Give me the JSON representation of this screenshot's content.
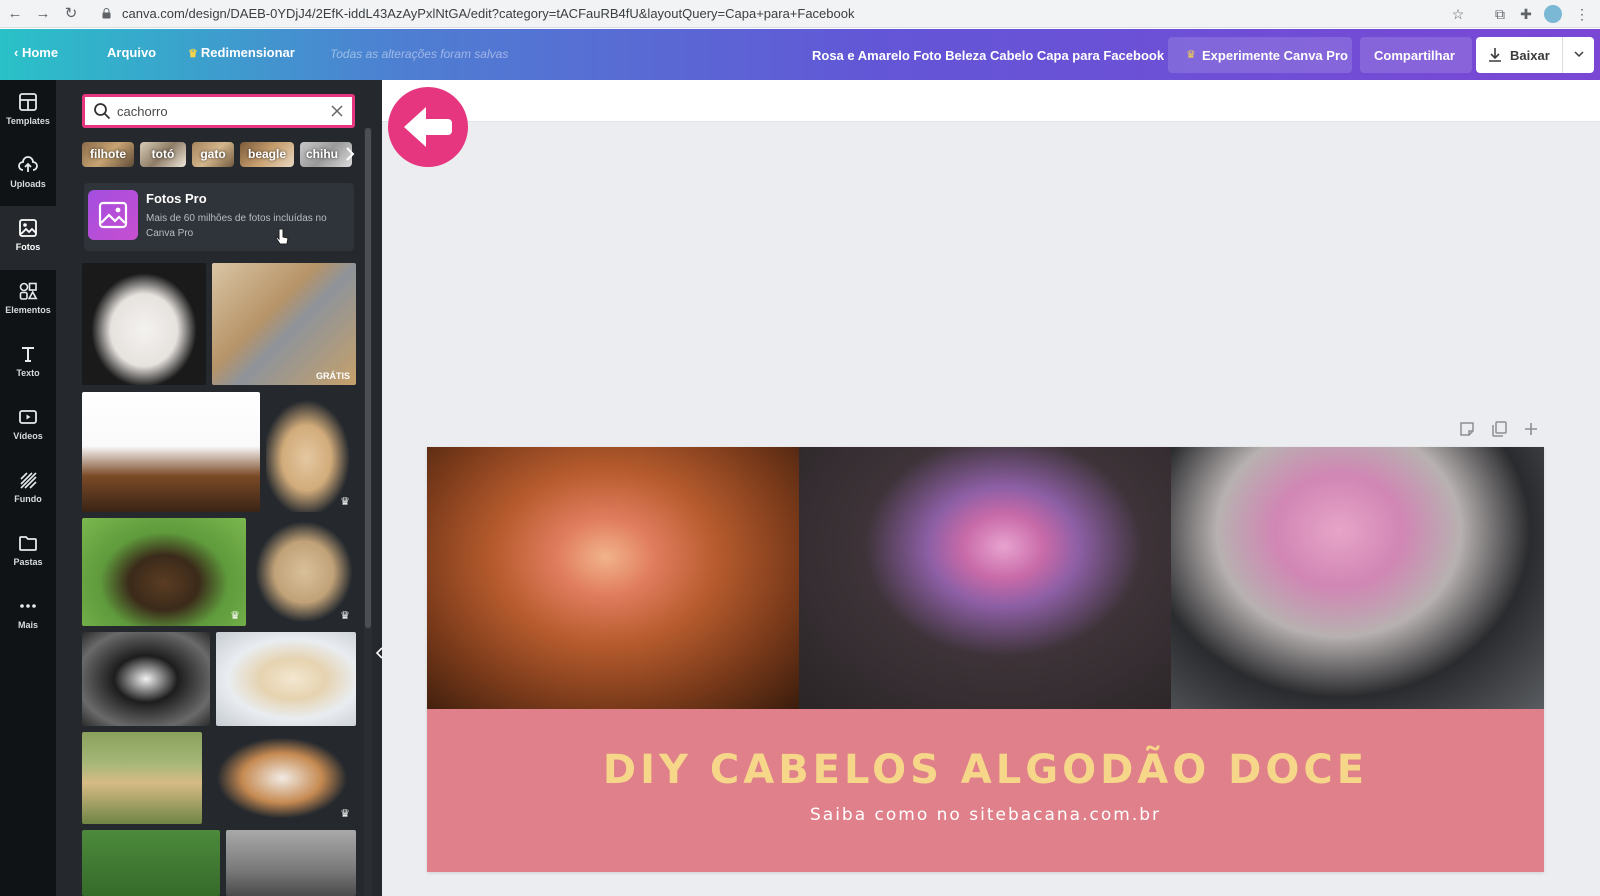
{
  "browser": {
    "url": "canva.com/design/DAEB-0YDjJ4/2EfK-iddL43AzAyPxlNtGA/edit?category=tACFauRB4fU&layoutQuery=Capa+para+Facebook"
  },
  "topbar": {
    "home_label": "Home",
    "file_label": "Arquivo",
    "resize_label": "Redimensionar",
    "saved_status": "Todas as alterações foram salvas",
    "doc_title": "Rosa e Amarelo Foto Beleza Cabelo Capa para Facebook",
    "pro_label": "Experimente Canva Pro",
    "share_label": "Compartilhar",
    "download_label": "Baixar"
  },
  "rail": {
    "items": [
      {
        "label": "Templates",
        "icon": "templates-icon"
      },
      {
        "label": "Uploads",
        "icon": "upload-icon"
      },
      {
        "label": "Fotos",
        "icon": "photos-icon"
      },
      {
        "label": "Elementos",
        "icon": "elements-icon"
      },
      {
        "label": "Texto",
        "icon": "text-icon"
      },
      {
        "label": "Vídeos",
        "icon": "video-icon"
      },
      {
        "label": "Fundo",
        "icon": "background-icon"
      },
      {
        "label": "Pastas",
        "icon": "folder-icon"
      },
      {
        "label": "Mais",
        "icon": "more-icon"
      }
    ],
    "active": "Fotos"
  },
  "panel": {
    "search_value": "cachorro",
    "chips": [
      "filhote",
      "totó",
      "gato",
      "beagle",
      "chihu"
    ],
    "fotos_pro": {
      "title": "Fotos Pro",
      "description": "Mais de 60 milhões de fotos incluídas no Canva Pro"
    },
    "gratis_badge": "GRÁTIS"
  },
  "design": {
    "headline": "DIY CABELOS ALGODÃO DOCE",
    "subline": "Saiba como no sitebacana.com.br"
  },
  "colors": {
    "accent_pink": "#e6367f",
    "design_bg": "#e0808a",
    "headline_color": "#f6d78a",
    "rail_bg": "#0f1316",
    "panel_bg": "#25292e"
  }
}
